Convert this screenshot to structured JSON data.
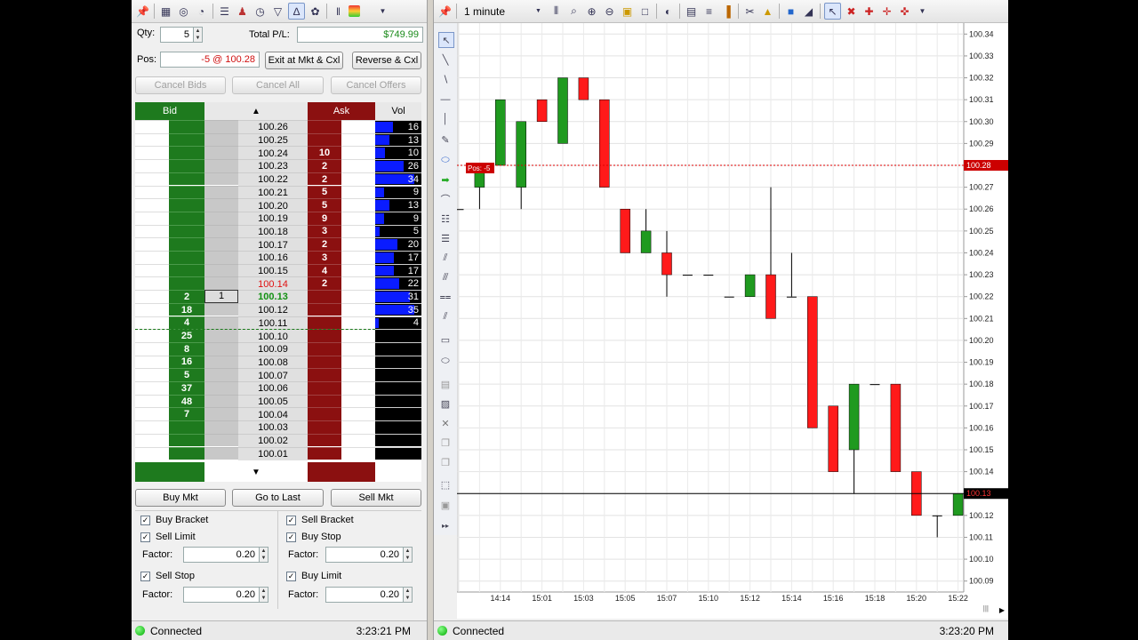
{
  "dom": {
    "qty_label": "Qty:",
    "qty_value": "5",
    "total_pl_label": "Total P/L:",
    "total_pl_value": "$749.99",
    "pos_label": "Pos:",
    "pos_value": "-5 @ 100.28",
    "exit_button": "Exit at Mkt & Cxl",
    "reverse_button": "Reverse & Cxl",
    "cancel_bids": "Cancel Bids",
    "cancel_all": "Cancel All",
    "cancel_offers": "Cancel Offers",
    "header_bid": "Bid",
    "header_ask": "Ask",
    "header_vol": "Vol",
    "buy_mkt": "Buy Mkt",
    "go_to_last": "Go to Last",
    "sell_mkt": "Sell Mkt",
    "buy_bracket": "Buy Bracket",
    "sell_bracket": "Sell Bracket",
    "sell_limit": "Sell Limit",
    "buy_stop": "Buy Stop",
    "sell_stop": "Sell Stop",
    "buy_limit": "Buy Limit",
    "factor_label": "Factor:",
    "factor_1": "0.20",
    "factor_2": "0.20",
    "factor_3": "0.20",
    "factor_4": "0.20",
    "status": "Connected",
    "time": "3:23:21 PM",
    "ladder": [
      {
        "price": "100.26",
        "bid": "",
        "ask": "",
        "vol": "16",
        "volpct": 0.38,
        "order": ""
      },
      {
        "price": "100.25",
        "bid": "",
        "ask": "",
        "vol": "13",
        "volpct": 0.3,
        "order": ""
      },
      {
        "price": "100.24",
        "bid": "",
        "ask": "10",
        "vol": "10",
        "volpct": 0.22,
        "order": ""
      },
      {
        "price": "100.23",
        "bid": "",
        "ask": "2",
        "vol": "26",
        "volpct": 0.62,
        "order": ""
      },
      {
        "price": "100.22",
        "bid": "",
        "ask": "2",
        "vol": "34",
        "volpct": 0.85,
        "order": ""
      },
      {
        "price": "100.21",
        "bid": "",
        "ask": "5",
        "vol": "9",
        "volpct": 0.2,
        "order": ""
      },
      {
        "price": "100.20",
        "bid": "",
        "ask": "5",
        "vol": "13",
        "volpct": 0.3,
        "order": ""
      },
      {
        "price": "100.19",
        "bid": "",
        "ask": "9",
        "vol": "9",
        "volpct": 0.2,
        "order": ""
      },
      {
        "price": "100.18",
        "bid": "",
        "ask": "3",
        "vol": "5",
        "volpct": 0.1,
        "order": ""
      },
      {
        "price": "100.17",
        "bid": "",
        "ask": "2",
        "vol": "20",
        "volpct": 0.48,
        "order": ""
      },
      {
        "price": "100.16",
        "bid": "",
        "ask": "3",
        "vol": "17",
        "volpct": 0.4,
        "order": ""
      },
      {
        "price": "100.15",
        "bid": "",
        "ask": "4",
        "vol": "17",
        "volpct": 0.4,
        "order": ""
      },
      {
        "price": "100.14",
        "bid": "",
        "ask": "2",
        "vol": "22",
        "volpct": 0.52,
        "order": "",
        "style": "red"
      },
      {
        "price": "100.13",
        "bid": "2",
        "ask": "",
        "vol": "31",
        "volpct": 0.75,
        "order": "1",
        "style": "last"
      },
      {
        "price": "100.12",
        "bid": "18",
        "ask": "",
        "vol": "35",
        "volpct": 0.85,
        "order": ""
      },
      {
        "price": "100.11",
        "bid": "4",
        "ask": "",
        "vol": "4",
        "volpct": 0.08,
        "order": ""
      },
      {
        "price": "100.10",
        "bid": "25",
        "ask": "",
        "vol": "",
        "volpct": 0,
        "order": ""
      },
      {
        "price": "100.09",
        "bid": "8",
        "ask": "",
        "vol": "",
        "volpct": 0,
        "order": ""
      },
      {
        "price": "100.08",
        "bid": "16",
        "ask": "",
        "vol": "",
        "volpct": 0,
        "order": ""
      },
      {
        "price": "100.07",
        "bid": "5",
        "ask": "",
        "vol": "",
        "volpct": 0,
        "order": ""
      },
      {
        "price": "100.06",
        "bid": "37",
        "ask": "",
        "vol": "",
        "volpct": 0,
        "order": ""
      },
      {
        "price": "100.05",
        "bid": "48",
        "ask": "",
        "vol": "",
        "volpct": 0,
        "order": ""
      },
      {
        "price": "100.04",
        "bid": "7",
        "ask": "",
        "vol": "",
        "volpct": 0,
        "order": ""
      },
      {
        "price": "100.03",
        "bid": "",
        "ask": "",
        "vol": "",
        "volpct": 0,
        "order": ""
      },
      {
        "price": "100.02",
        "bid": "",
        "ask": "",
        "vol": "",
        "volpct": 0,
        "order": ""
      },
      {
        "price": "100.01",
        "bid": "",
        "ask": "",
        "vol": "",
        "volpct": 0,
        "order": ""
      }
    ]
  },
  "chart": {
    "interval": "1 minute",
    "status": "Connected",
    "time": "3:23:20 PM",
    "pos_marker": "Pos: -5",
    "pos_price": "100.28",
    "last_price": "100.13"
  },
  "colors": {
    "bid_green": "#1e7a1e",
    "ask_red": "#8b1010",
    "vol_blue": "#0a1cff",
    "up_candle": "#1f9a1f",
    "down_candle": "#ff1a1a"
  },
  "chart_data": {
    "type": "candlestick",
    "ylim": [
      100.085,
      100.345
    ],
    "y_ticks": [
      "100.34",
      "100.33",
      "100.32",
      "100.31",
      "100.30",
      "100.29",
      "100.28",
      "100.27",
      "100.26",
      "100.25",
      "100.24",
      "100.23",
      "100.22",
      "100.21",
      "100.20",
      "100.19",
      "100.18",
      "100.17",
      "100.16",
      "100.15",
      "100.14",
      "100.13",
      "100.12",
      "100.11",
      "100.10",
      "100.09"
    ],
    "x_labels": [
      "14:14",
      "15:01",
      "15:03",
      "15:05",
      "15:07",
      "15:10",
      "15:12",
      "15:14",
      "15:16",
      "15:18",
      "15:20",
      "15:22"
    ],
    "candles": [
      {
        "o": 100.26,
        "h": 100.26,
        "l": 100.26,
        "c": 100.26
      },
      {
        "o": 100.27,
        "h": 100.28,
        "l": 100.26,
        "c": 100.28
      },
      {
        "o": 100.28,
        "h": 100.31,
        "l": 100.28,
        "c": 100.31
      },
      {
        "o": 100.27,
        "h": 100.3,
        "l": 100.26,
        "c": 100.3
      },
      {
        "o": 100.31,
        "h": 100.31,
        "l": 100.3,
        "c": 100.3
      },
      {
        "o": 100.29,
        "h": 100.32,
        "l": 100.29,
        "c": 100.32
      },
      {
        "o": 100.32,
        "h": 100.32,
        "l": 100.31,
        "c": 100.31
      },
      {
        "o": 100.31,
        "h": 100.31,
        "l": 100.27,
        "c": 100.27
      },
      {
        "o": 100.26,
        "h": 100.26,
        "l": 100.24,
        "c": 100.24
      },
      {
        "o": 100.24,
        "h": 100.26,
        "l": 100.24,
        "c": 100.25
      },
      {
        "o": 100.24,
        "h": 100.25,
        "l": 100.22,
        "c": 100.23
      },
      {
        "o": 100.23,
        "h": 100.23,
        "l": 100.23,
        "c": 100.23
      },
      {
        "o": 100.23,
        "h": 100.23,
        "l": 100.23,
        "c": 100.23
      },
      {
        "o": 100.22,
        "h": 100.22,
        "l": 100.22,
        "c": 100.22
      },
      {
        "o": 100.22,
        "h": 100.23,
        "l": 100.22,
        "c": 100.23
      },
      {
        "o": 100.23,
        "h": 100.27,
        "l": 100.21,
        "c": 100.21
      },
      {
        "o": 100.22,
        "h": 100.24,
        "l": 100.22,
        "c": 100.22
      },
      {
        "o": 100.22,
        "h": 100.22,
        "l": 100.16,
        "c": 100.16
      },
      {
        "o": 100.17,
        "h": 100.17,
        "l": 100.14,
        "c": 100.14
      },
      {
        "o": 100.15,
        "h": 100.18,
        "l": 100.13,
        "c": 100.18
      },
      {
        "o": 100.18,
        "h": 100.18,
        "l": 100.18,
        "c": 100.18
      },
      {
        "o": 100.18,
        "h": 100.18,
        "l": 100.14,
        "c": 100.14
      },
      {
        "o": 100.14,
        "h": 100.14,
        "l": 100.12,
        "c": 100.12
      },
      {
        "o": 100.12,
        "h": 100.12,
        "l": 100.11,
        "c": 100.12
      },
      {
        "o": 100.12,
        "h": 100.13,
        "l": 100.12,
        "c": 100.13
      }
    ]
  }
}
